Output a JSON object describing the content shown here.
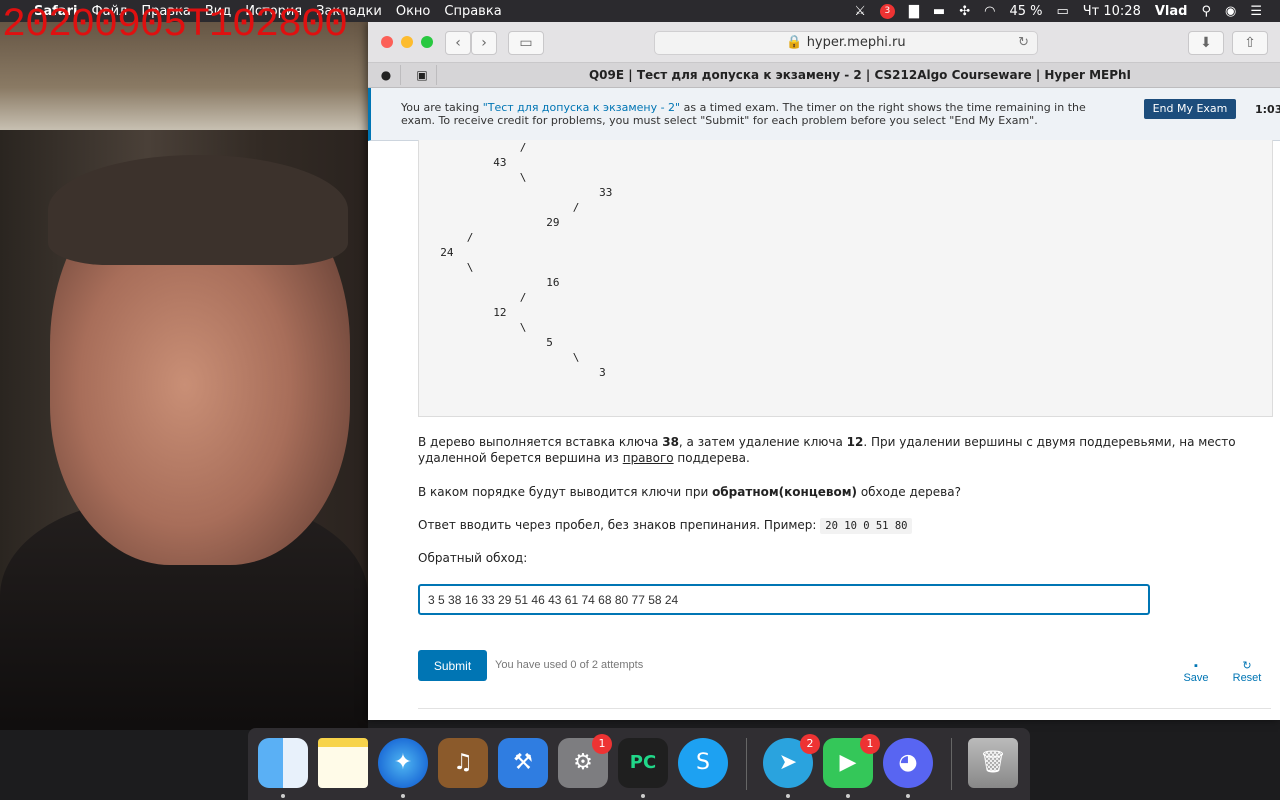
{
  "overlay": {
    "timestamp": "20200905T102800"
  },
  "menubar": {
    "app": "Safari",
    "items": [
      "Файл",
      "Правка",
      "Вид",
      "История",
      "Закладки",
      "Окно",
      "Справка"
    ],
    "battery": "45 %",
    "clock": "Чт 10:28",
    "user": "Vlad",
    "notification_badge": "3"
  },
  "browser": {
    "url": "hyper.mephi.ru",
    "tab_title": "Q09E | Тест для допуска к экзамену - 2 | CS212Algo Courseware | Hyper MEPhI"
  },
  "exam_banner": {
    "text_before": "You are taking ",
    "exam_link": "\"Тест для допуска к экзамену - 2\"",
    "text_after": " as a timed exam. The timer on the right shows the time remaining in the exam. To receive credit for problems, you must select \"Submit\" for each problem before you select \"End My Exam\".",
    "end_button": "End My Exam",
    "timer": "1:03:"
  },
  "problem": {
    "tree_text": "              /\n          43\n              \\\n                          33\n                      /\n                  29\n      /\n  24\n      \\\n                  16\n              /\n          12\n              \\\n                  5\n                      \\\n                          3",
    "p1_a": "В дерево выполняется вставка ключа ",
    "p1_key1": "38",
    "p1_b": ", а затем удаление ключа ",
    "p1_key2": "12",
    "p1_c": ". При удалении вершины с двумя поддеревьями, на место удаленной берется вершина из ",
    "p1_right": "правого",
    "p1_d": " поддерева.",
    "p2_a": "В каком порядке будут выводится ключи при ",
    "p2_bold": "обратном(концевом)",
    "p2_b": " обходе дерева?",
    "p3_a": "Ответ вводить через пробел, без знаков препинания. Пример: ",
    "p3_example": "20 10 0 51 80",
    "p4": "Обратный обход:",
    "answer_value": "3 5 38 16 33 29 51 46 43 61 74 68 80 77 58 24",
    "submit_label": "Submit",
    "attempts_text": "You have used 0 of 2 attempts",
    "save_label": "Save",
    "reset_label": "Reset"
  },
  "dock": {
    "apps": [
      "finder",
      "notes",
      "safari",
      "garageband",
      "xcode",
      "system-preferences",
      "pycharm",
      "skype",
      "telegram",
      "facetime",
      "discord",
      "trash"
    ],
    "badges": {
      "system_preferences": "1",
      "telegram": "2",
      "facetime": "1"
    },
    "pycharm_label": "PC"
  }
}
